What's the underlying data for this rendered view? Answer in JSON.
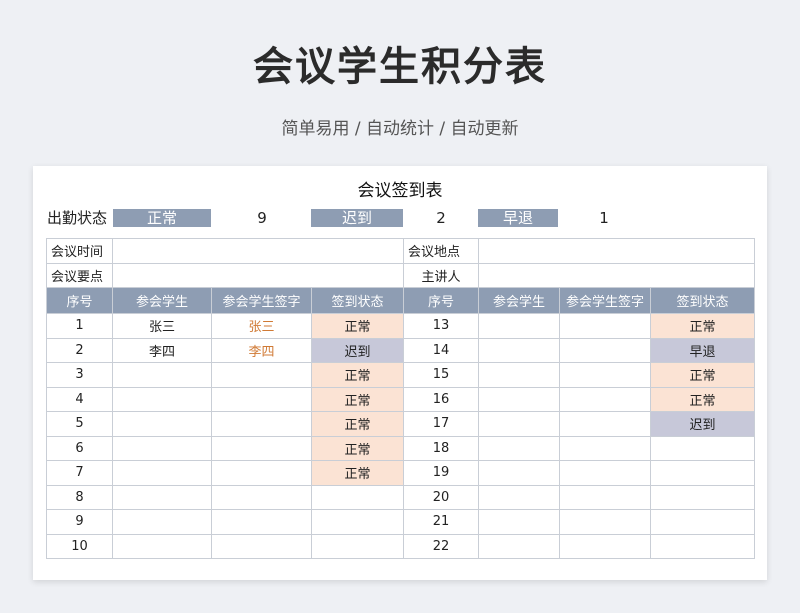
{
  "page": {
    "title": "会议学生积分表",
    "subtitle": "简单易用 / 自动统计 / 自动更新"
  },
  "sheet": {
    "title": "会议签到表",
    "stats": {
      "label": "出勤状态",
      "normal_label": "正常",
      "normal_count": "9",
      "late_label": "迟到",
      "late_count": "2",
      "early_label": "早退",
      "early_count": "1"
    },
    "info": {
      "time_label": "会议时间",
      "place_label": "会议地点",
      "topic_label": "会议要点",
      "host_label": "主讲人"
    },
    "headers": [
      "序号",
      "参会学生",
      "参会学生签字",
      "签到状态",
      "序号",
      "参会学生",
      "参会学生签字",
      "签到状态"
    ],
    "left_rows": [
      {
        "no": "1",
        "name": "张三",
        "sign": "张三",
        "status": "正常"
      },
      {
        "no": "2",
        "name": "李四",
        "sign": "李四",
        "status": "迟到"
      },
      {
        "no": "3",
        "name": "",
        "sign": "",
        "status": "正常"
      },
      {
        "no": "4",
        "name": "",
        "sign": "",
        "status": "正常"
      },
      {
        "no": "5",
        "name": "",
        "sign": "",
        "status": "正常"
      },
      {
        "no": "6",
        "name": "",
        "sign": "",
        "status": "正常"
      },
      {
        "no": "7",
        "name": "",
        "sign": "",
        "status": "正常"
      },
      {
        "no": "8",
        "name": "",
        "sign": "",
        "status": ""
      },
      {
        "no": "9",
        "name": "",
        "sign": "",
        "status": ""
      },
      {
        "no": "10",
        "name": "",
        "sign": "",
        "status": ""
      }
    ],
    "right_rows": [
      {
        "no": "13",
        "name": "",
        "sign": "",
        "status": "正常"
      },
      {
        "no": "14",
        "name": "",
        "sign": "",
        "status": "早退"
      },
      {
        "no": "15",
        "name": "",
        "sign": "",
        "status": "正常"
      },
      {
        "no": "16",
        "name": "",
        "sign": "",
        "status": "正常"
      },
      {
        "no": "17",
        "name": "",
        "sign": "",
        "status": "迟到"
      },
      {
        "no": "18",
        "name": "",
        "sign": "",
        "status": ""
      },
      {
        "no": "19",
        "name": "",
        "sign": "",
        "status": ""
      },
      {
        "no": "20",
        "name": "",
        "sign": "",
        "status": ""
      },
      {
        "no": "21",
        "name": "",
        "sign": "",
        "status": ""
      },
      {
        "no": "22",
        "name": "",
        "sign": "",
        "status": ""
      }
    ],
    "colors": {
      "header_bg": "#8e9db3",
      "normal_bg": "#fbe3d4",
      "late_bg": "#c7c8d9",
      "early_bg": "#c7c8d9",
      "signature": "#d07a35"
    }
  }
}
